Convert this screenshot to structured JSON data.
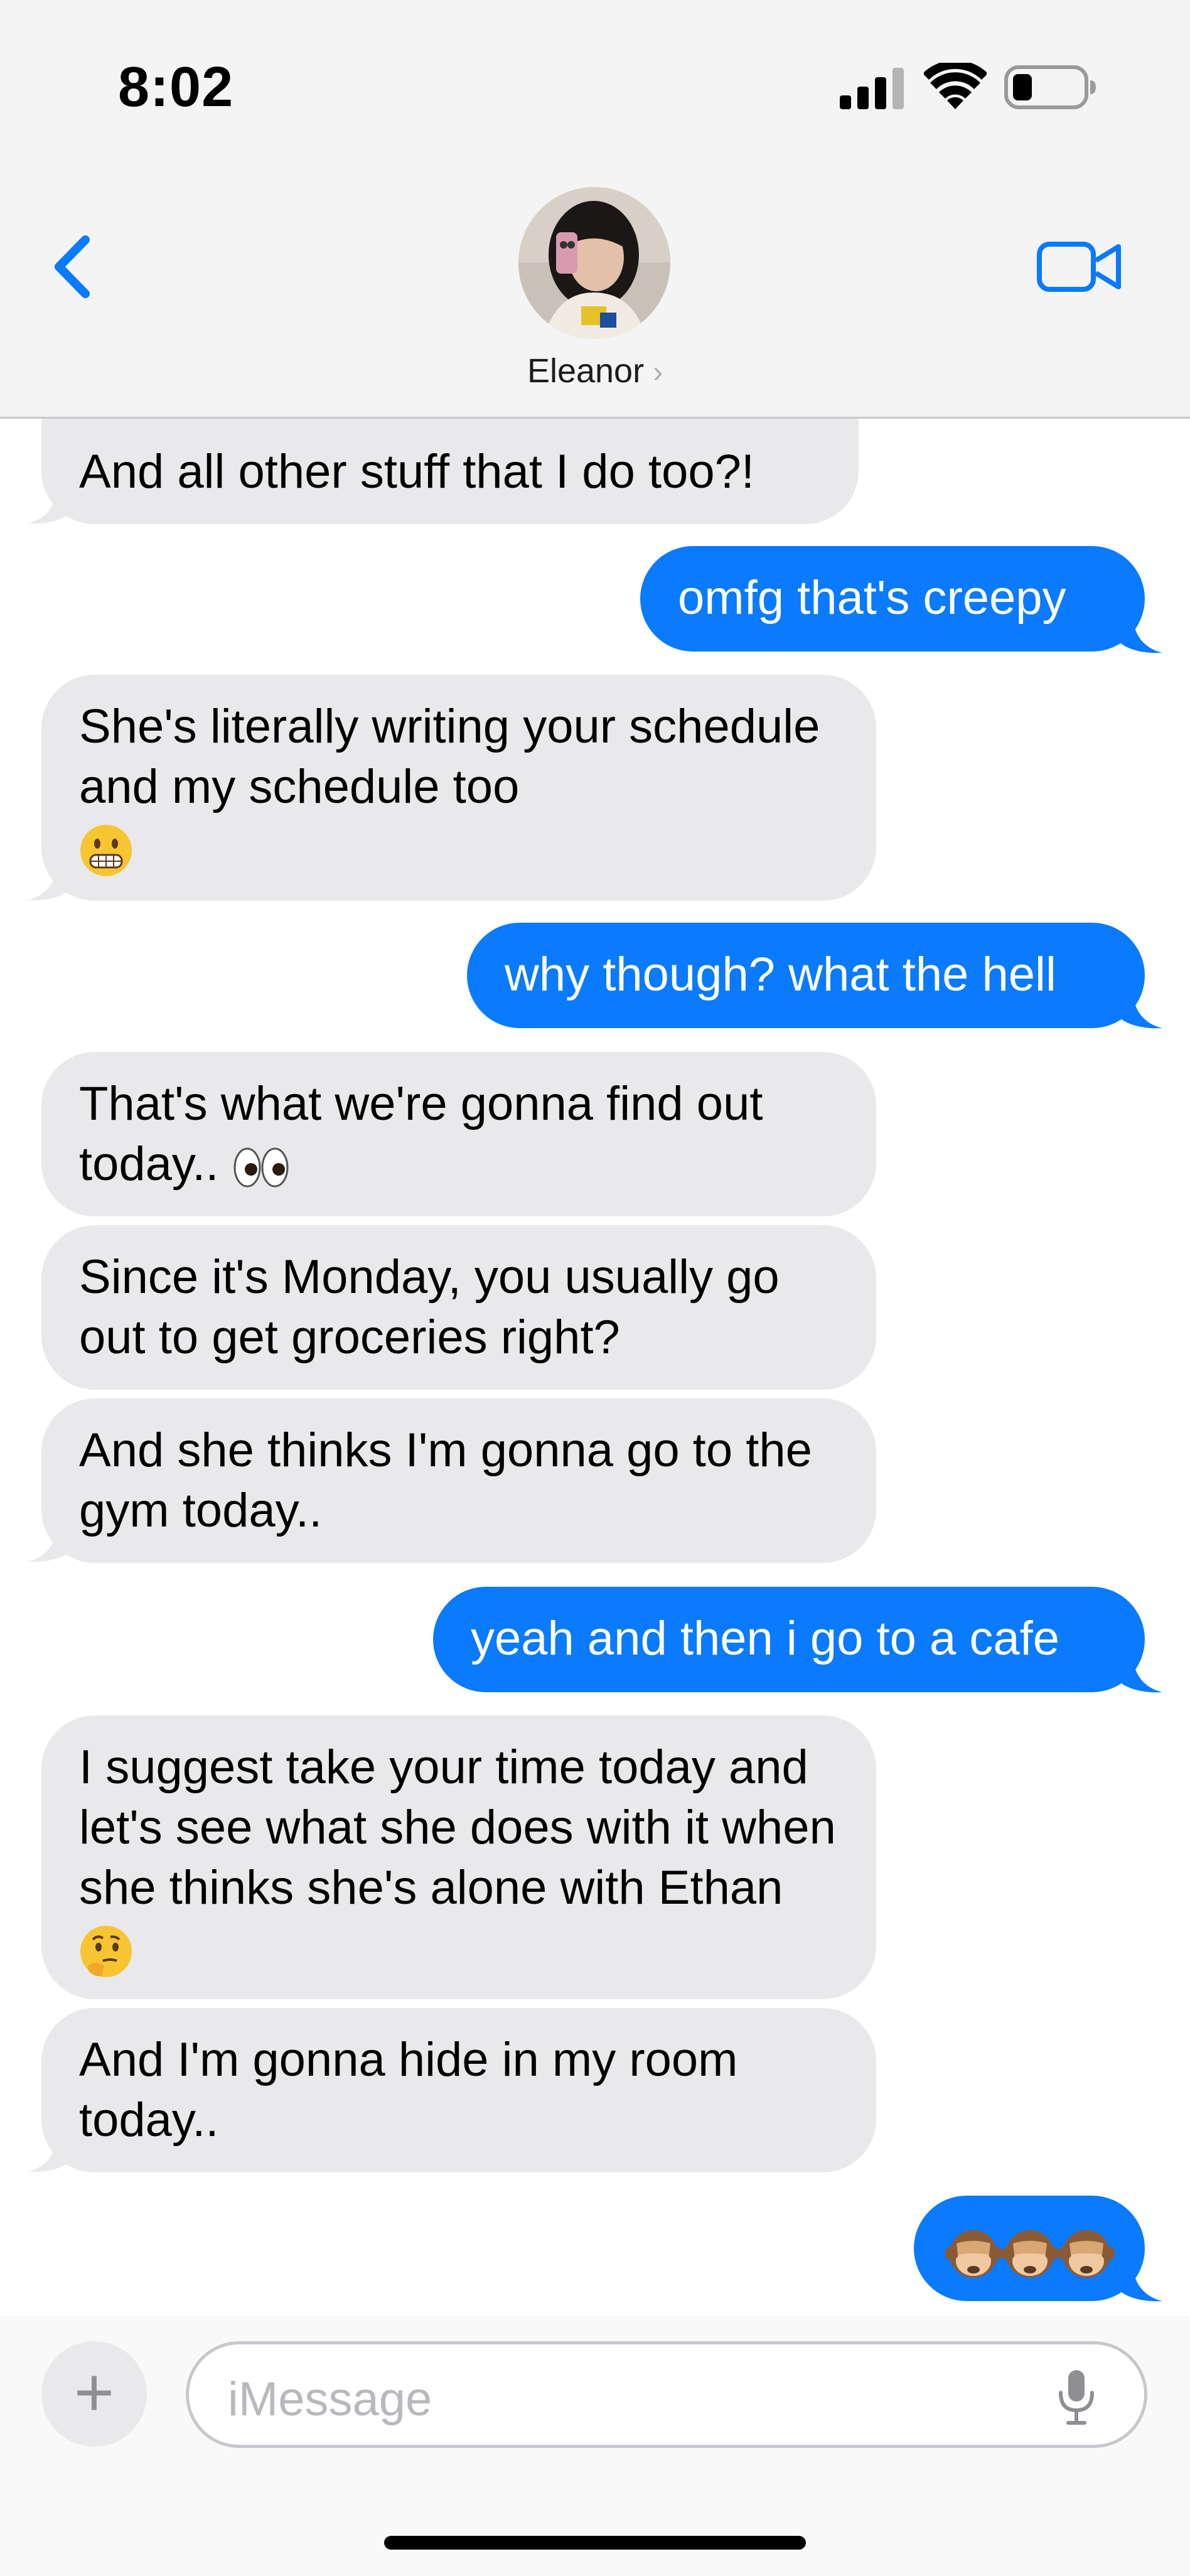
{
  "status_bar": {
    "time": "8:02",
    "icons": [
      "cellular-signal-icon",
      "wifi-icon",
      "battery-icon"
    ]
  },
  "header": {
    "contact_name": "Eleanor",
    "contact_chevron": "›",
    "back_icon": "chevron-left-icon",
    "video_icon": "video-camera-icon"
  },
  "messages": [
    {
      "side": "received",
      "text": "And all other stuff that I do too?!"
    },
    {
      "side": "sent",
      "text": "omfg that's creepy"
    },
    {
      "side": "received",
      "text": "She's literally writing your schedule and my schedule too",
      "emoji": "grimacing-face"
    },
    {
      "side": "sent",
      "text": "why though? what the hell"
    },
    {
      "side": "received",
      "text": "That's what we're gonna find out today..",
      "emoji": "eyes"
    },
    {
      "side": "received",
      "text": "Since it's Monday, you usually go out to get groceries right?"
    },
    {
      "side": "received",
      "text": "And she thinks I'm gonna go to the gym today.."
    },
    {
      "side": "sent",
      "text": "yeah and then i go to a cafe"
    },
    {
      "side": "received",
      "text": "I suggest take your time today and let's see what she does with it when she thinks she's alone with Ethan",
      "emoji": "thinking-face"
    },
    {
      "side": "received",
      "text": "And I'm gonna hide in my room today.."
    },
    {
      "side": "sent",
      "text": "",
      "emoji": "see-no-evil-monkey x3"
    }
  ],
  "input": {
    "placeholder": "iMessage",
    "plus_label": "+",
    "mic_icon": "microphone-icon"
  },
  "colors": {
    "sent_bubble": "#0a7aff",
    "received_bubble": "#e9e9eb",
    "accent": "#0a7aff"
  }
}
